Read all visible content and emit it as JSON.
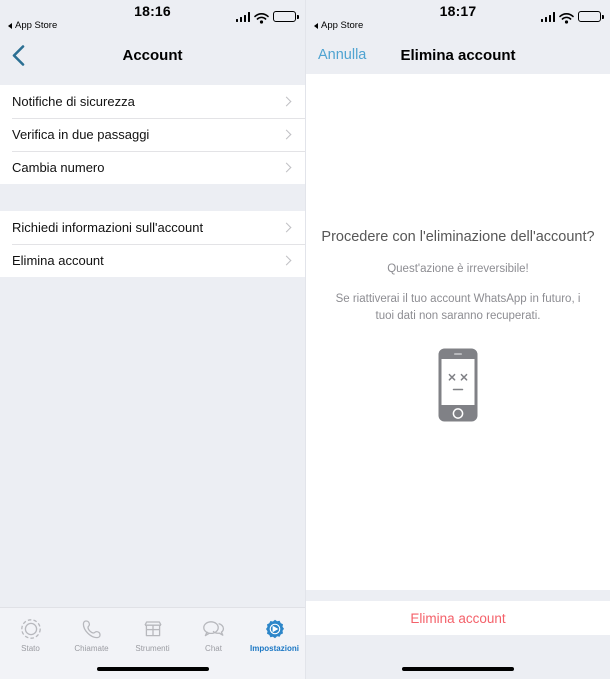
{
  "left": {
    "status": {
      "time": "18:16",
      "back_app": "App Store",
      "signal_icon": "signal-bars-icon",
      "wifi_icon": "wifi-icon",
      "battery_icon": "battery-icon"
    },
    "nav": {
      "back_icon": "chevron-left-icon",
      "title": "Account",
      "back_color": "#2b6f93"
    },
    "groups": [
      {
        "rows": [
          {
            "label": "Notifiche di sicurezza",
            "accessory": "chevron-right-icon"
          },
          {
            "label": "Verifica in due passaggi",
            "accessory": "chevron-right-icon"
          },
          {
            "label": "Cambia numero",
            "accessory": "chevron-right-icon"
          }
        ]
      },
      {
        "rows": [
          {
            "label": "Richiedi informazioni sull'account",
            "accessory": "chevron-right-icon"
          },
          {
            "label": "Elimina account",
            "accessory": "chevron-right-icon"
          }
        ]
      }
    ],
    "tabs": [
      {
        "label": "Stato",
        "icon": "status-rings-icon",
        "active": false
      },
      {
        "label": "Chiamate",
        "icon": "phone-handset-icon",
        "active": false
      },
      {
        "label": "Strumenti",
        "icon": "storefront-icon",
        "active": false
      },
      {
        "label": "Chat",
        "icon": "chat-bubbles-icon",
        "active": false
      },
      {
        "label": "Impostazioni",
        "icon": "gear-icon",
        "active": true
      }
    ],
    "active_tab_color": "#1b77c4"
  },
  "right": {
    "status": {
      "time": "18:17",
      "back_app": "App Store",
      "signal_icon": "signal-bars-icon",
      "wifi_icon": "wifi-icon",
      "battery_icon": "battery-icon"
    },
    "nav": {
      "cancel_label": "Annulla",
      "title": "Elimina account",
      "cancel_color": "#4fa3d1"
    },
    "body": {
      "question": "Procedere con l'eliminazione dell'account?",
      "warning": "Quest'azione è irreversibile!",
      "note": "Se riattiverai il tuo account WhatsApp in futuro, i tuoi dati non saranno recuperati.",
      "illustration_icon": "sad-phone-icon"
    },
    "action": {
      "label": "Elimina account",
      "color": "#f4616a"
    }
  }
}
